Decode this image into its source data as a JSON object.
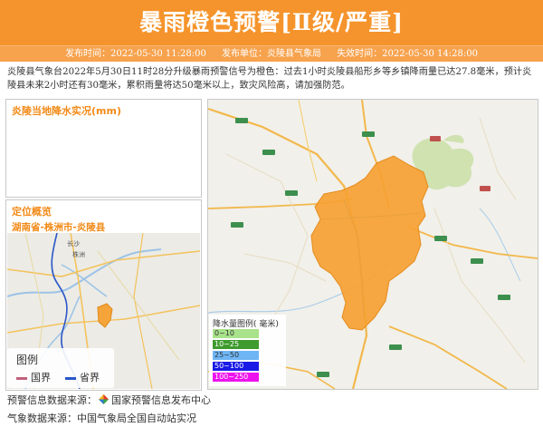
{
  "header": {
    "title": "暴雨橙色预警[Ⅱ级/严重]",
    "publish_time": "发布时间：2022-05-30 11:28:00",
    "publisher": "发布单位：炎陵县气象局",
    "expire_time": "失效时间：2022-05-30 14:28:00"
  },
  "description": "炎陵县气象台2022年5月30日11时28分升级暴雨预警信号为橙色：过去1小时炎陵县船形乡等乡镇降雨量已达27.8毫米，预计炎陵县未来2小时还有30毫米，累积雨量将达50毫米以上，致灾风险高，请加强防范。",
  "rain_panel": {
    "title": "炎陵当地降水实况(mm)"
  },
  "location_panel": {
    "title": "定位概览",
    "region": "湖南省-株洲市-炎陵县",
    "map_labels": [
      "长沙",
      "株洲"
    ]
  },
  "mini_legend": {
    "title": "图例",
    "items": [
      {
        "label": "国界",
        "color": "#c0607a"
      },
      {
        "label": "省界",
        "color": "#2a56c8"
      }
    ]
  },
  "rain_legend": {
    "title": "降水量图例( 毫米)",
    "items": [
      {
        "label": "0~10",
        "color": "#a8e28a"
      },
      {
        "label": "10~25",
        "color": "#3f9b2e"
      },
      {
        "label": "25~50",
        "color": "#6eb5f5"
      },
      {
        "label": "50~100",
        "color": "#1a1ae6"
      },
      {
        "label": "100~250",
        "color": "#ee12ee"
      }
    ]
  },
  "sources": {
    "warning": "预警信息数据来源：",
    "warning_org": "国家预警信息发布中心",
    "weather": "气象数据来源：中国气象局全国自动站实况"
  }
}
